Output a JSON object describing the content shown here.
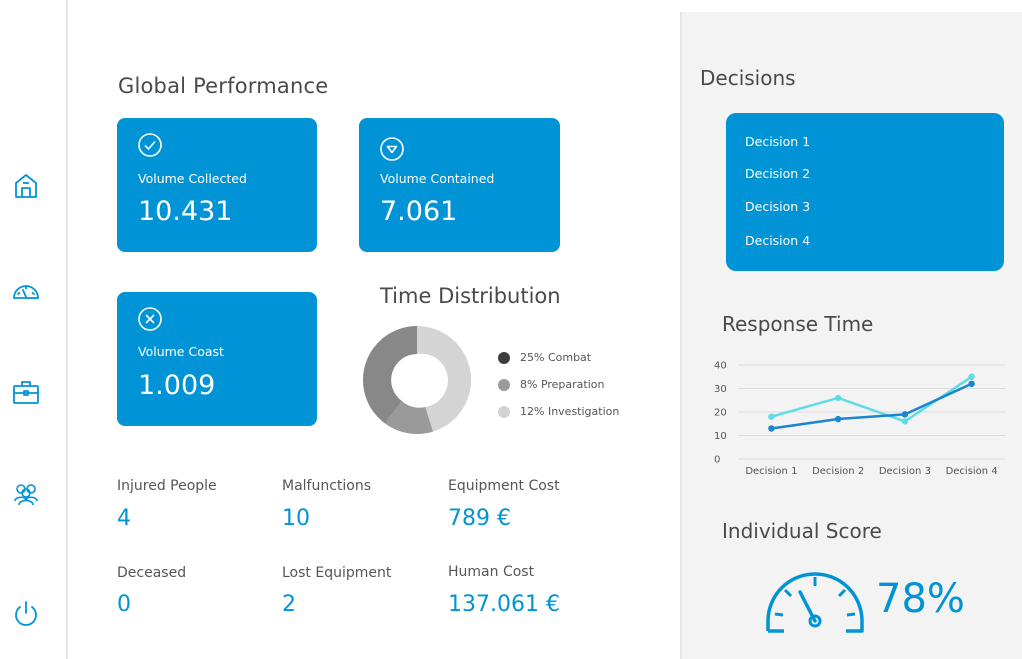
{
  "main": {
    "title": "Global Performance",
    "cards": [
      {
        "label": "Volume Collected",
        "value": "10.431",
        "icon": "check-circle-icon"
      },
      {
        "label": "Volume Contained",
        "value": "7.061",
        "icon": "triangle-circle-icon"
      },
      {
        "label": "Volume Coast",
        "value": "1.009",
        "icon": "x-circle-icon"
      }
    ],
    "time_distribution": {
      "title": "Time Distribution",
      "legend": [
        {
          "label": "25% Combat",
          "color": "#3d3d3d"
        },
        {
          "label": "8% Preparation",
          "color": "#9a9a9a"
        },
        {
          "label": "12% Investigation",
          "color": "#d4d4d4"
        }
      ]
    },
    "stats": [
      {
        "label": "Injured People",
        "value": "4"
      },
      {
        "label": "Malfunctions",
        "value": "10"
      },
      {
        "label": "Equipment Cost",
        "value": "789 €"
      },
      {
        "label": "Deceased",
        "value": "0"
      },
      {
        "label": "Lost Equipment",
        "value": "2"
      },
      {
        "label": "Human Cost",
        "value": "137.061 €"
      }
    ]
  },
  "sidebar": {
    "icons": [
      "home-icon",
      "speedometer-icon",
      "briefcase-icon",
      "users-icon",
      "power-icon"
    ]
  },
  "right": {
    "decisions_title": "Decisions",
    "decisions": [
      "Decision 1",
      "Decision 2",
      "Decision 3",
      "Decision 4"
    ],
    "response_title": "Response Time",
    "score_title": "Individual Score",
    "score_value": "78%",
    "score_fraction": 0.78
  },
  "colors": {
    "accent": "#0094d6",
    "series_light": "#5ddce4",
    "series_dark": "#1a86cf"
  },
  "chart_data": {
    "type": "line",
    "categories": [
      "Decision 1",
      "Decision 2",
      "Decision 3",
      "Decision 4"
    ],
    "series": [
      {
        "values": [
          18,
          26,
          16,
          35
        ],
        "color": "#5ddce4"
      },
      {
        "values": [
          13,
          17,
          19,
          32
        ],
        "color": "#1a86cf"
      }
    ],
    "yticks": [
      0,
      10,
      20,
      30,
      40
    ],
    "ylim": [
      0,
      40
    ],
    "grid": true
  }
}
